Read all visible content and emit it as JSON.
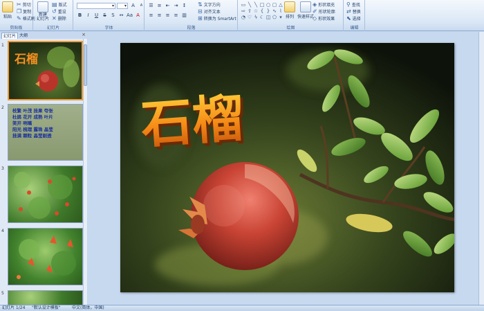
{
  "ribbon": {
    "clipboard": {
      "label": "剪贴板",
      "paste": "粘贴",
      "cut": "剪切",
      "copy": "复制",
      "format_painter": "格式刷"
    },
    "slides": {
      "label": "幻灯片",
      "new_slide": "新建\n幻灯片",
      "layout": "版式",
      "reset": "重设",
      "delete": "删除"
    },
    "font": {
      "label": "字体",
      "font_value": "",
      "size_value": ""
    },
    "paragraph": {
      "label": "段落",
      "text_direction": "文字方向",
      "align_text": "对齐文本",
      "smartart": "转换为 SmartArt"
    },
    "drawing": {
      "label": "绘图",
      "arrange": "排列",
      "quick_styles": "快速样式",
      "shape_fill": "形状填充",
      "shape_outline": "形状轮廓",
      "shape_effects": "形状效果"
    },
    "editing": {
      "label": "编辑",
      "find": "查找",
      "replace": "替换",
      "select": "选择"
    }
  },
  "left_pane": {
    "tabs": [
      "幻灯片",
      "大纲"
    ],
    "slides": [
      {
        "number": "1",
        "title": "石榴"
      },
      {
        "number": "2",
        "lines": [
          "枝繁 叶茂 挂果 夸张",
          "杜鹃 花开 成熟 叶片",
          "笑开 咧嘴",
          "阳光 梳理 露珠 晶莹",
          "挂满 颗粒 晶莹剔透"
        ]
      },
      {
        "number": "3"
      },
      {
        "number": "4"
      },
      {
        "number": "5"
      }
    ]
  },
  "slide": {
    "title": "石榴"
  },
  "status_bar": {
    "slide_info": "幻灯片 1/24",
    "theme": "\"默认设计模板\"",
    "language": "中文(简体，中国)"
  },
  "colors": {
    "accent": "#f29b35",
    "ribbon_bg": "#dbe8f6",
    "pane_bg": "#c6d9ef"
  }
}
